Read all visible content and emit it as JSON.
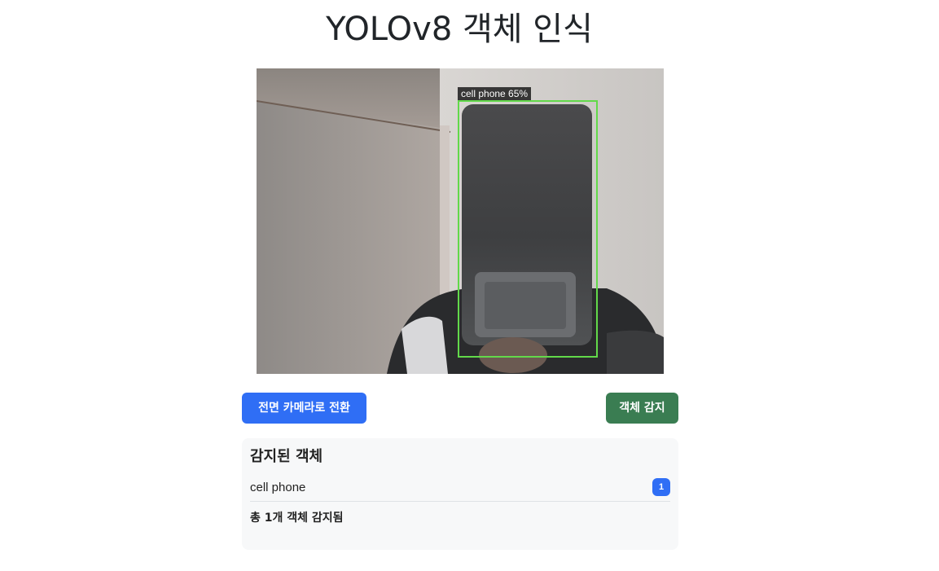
{
  "page": {
    "title": "YOLOv8 객체 인식"
  },
  "video": {
    "detection_label": "cell phone 65%",
    "box_color": "#62d94a"
  },
  "controls": {
    "switch_camera_label": "전면 카메라로 전환",
    "detect_label": "객체 감지",
    "switch_color": "#2f6ef5",
    "detect_color": "#3a7d52"
  },
  "results": {
    "heading": "감지된 객체",
    "items": [
      {
        "name": "cell phone",
        "count": "1"
      }
    ],
    "summary": "총 1개 객체 감지됨"
  }
}
